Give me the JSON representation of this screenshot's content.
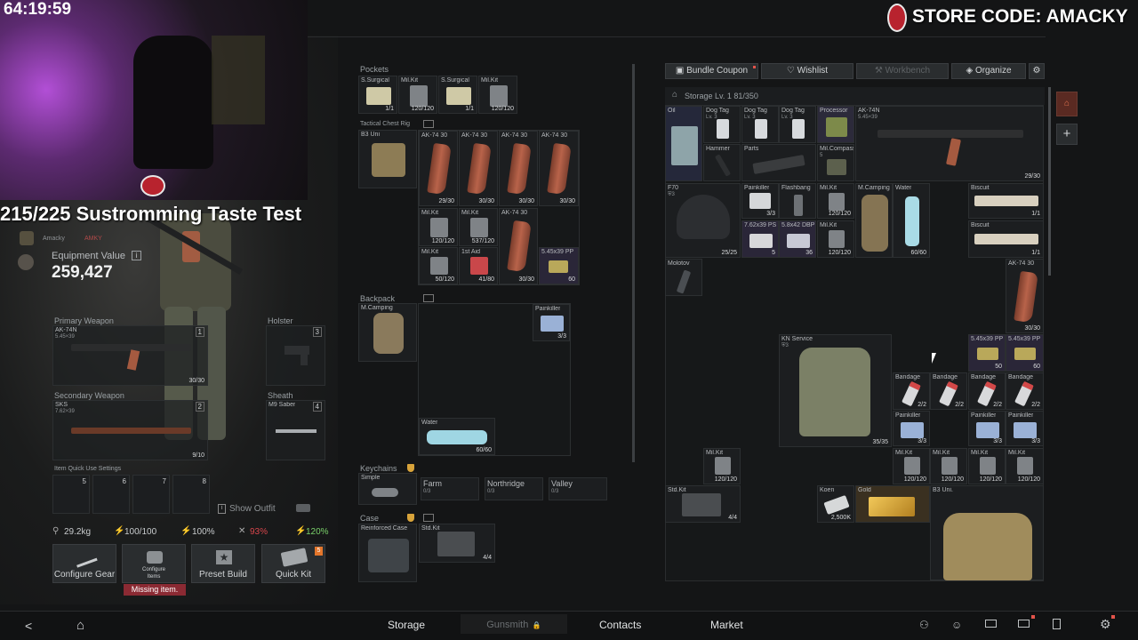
{
  "stream": {
    "timer": "64:19:59",
    "store_code": "STORE CODE: AMACKY",
    "title": "215/225 Sustromming Taste Test",
    "user_name": "Amacky",
    "user_tag": "AMKY"
  },
  "character": {
    "equipment_value_label": "Equipment Value",
    "equipment_value": "259,427",
    "primary_weapon": {
      "section": "Primary Weapon",
      "name": "AK-74N",
      "caliber": "5.45×39",
      "slot": "1",
      "ammo": "30/30"
    },
    "holster": {
      "section": "Holster",
      "slot": "3"
    },
    "secondary_weapon": {
      "section": "Secondary Weapon",
      "name": "SKS",
      "caliber": "7.62×39",
      "slot": "2",
      "ammo": "9/10"
    },
    "sheath": {
      "section": "Sheath",
      "name": "M9 Saber",
      "slot": "4"
    },
    "quick_use_label": "Item Quick Use Settings",
    "quick_use_slots": [
      "5",
      "6",
      "7",
      "8"
    ],
    "show_outfit": "Show Outfit",
    "stats": [
      "29.2kg",
      "100/100",
      "100%",
      "93%",
      "120%"
    ],
    "colors": {
      "stat_warning": "#d8464c",
      "stat_good": "#7ad16a"
    },
    "buttons": {
      "configure_gear": "Configure Gear",
      "configure_items": "Configure Items",
      "preset_build": "Preset Build",
      "quick_kit": "Quick Kit",
      "quick_kit_badge": "5"
    },
    "missing_item": "Missing item."
  },
  "loadout": {
    "pockets_label": "Pockets",
    "pockets": [
      {
        "name": "S.Surgical",
        "count": "1/1"
      },
      {
        "name": "Mil.Kit",
        "count": "120/120"
      },
      {
        "name": "S.Surgical",
        "count": "1/1"
      },
      {
        "name": "Mil.Kit",
        "count": "120/120"
      }
    ],
    "rig_label": "Tactical Chest Rig",
    "rig_name": "B3 Uni",
    "rig_items": [
      {
        "name": "AK-74 30",
        "count": "29/30"
      },
      {
        "name": "AK-74 30",
        "count": "30/30"
      },
      {
        "name": "AK-74 30",
        "count": "30/30"
      },
      {
        "name": "AK-74 30",
        "count": "30/30"
      },
      {
        "name": "Mil.Kit",
        "count": "120/120"
      },
      {
        "name": "Mil.Kit",
        "count": "537/120"
      },
      {
        "name": "AK-74 30",
        "count": "30/30"
      },
      {
        "name": "Mil.Kit",
        "count": "50/120"
      },
      {
        "name": "1st Aid",
        "count": "41/80"
      },
      {
        "name": "5.45x39 PP",
        "count": "60"
      }
    ],
    "backpack_label": "Backpack",
    "backpack_name": "M.Camping",
    "backpack_items": [
      {
        "name": "Painkiller",
        "count": "3/3"
      },
      {
        "name": "Water",
        "count": "60/60"
      }
    ],
    "keychains_label": "Keychains",
    "keychain_name": "Simple",
    "keys": [
      {
        "name": "Farm",
        "count": "0/3"
      },
      {
        "name": "Northridge",
        "count": "0/3"
      },
      {
        "name": "Valley",
        "count": "0/3"
      }
    ],
    "case_label": "Case",
    "case_name": "Reinforced Case",
    "case_items": [
      {
        "name": "Std.Kit",
        "count": "4/4"
      }
    ]
  },
  "storage": {
    "tabs": [
      "Bundle Coupon",
      "Wishlist",
      "Workbench",
      "Organize"
    ],
    "title": "Storage Lv. 1 81/350",
    "items": {
      "oil": "Oil",
      "dog_tag_1": "Dog Tag",
      "dog_tag_1_lv": "Lv. 3",
      "dog_tag_2": "Dog Tag",
      "dog_tag_2_lv": "Lv. 3",
      "dog_tag_3": "Dog Tag",
      "dog_tag_3_lv": "Lv. 3",
      "processor": "Processor",
      "ak74n": "AK-74N",
      "ak74n_cal": "5.45×39",
      "ak74n_ammo": "29/30",
      "hammer": "Hammer",
      "parts": "Parts",
      "mil_compass": "Mil.Compass",
      "mil_compass_count": "5",
      "f70": "F70",
      "f70_tier": "3",
      "f70_count": "25/25",
      "painkiller": "Painkiller",
      "painkiller_count": "3/3",
      "flashbang": "Flashbang",
      "milkit_a": "Mil.Kit",
      "milkit_a_count": "120/120",
      "mcamping": "M.Camping",
      "water": "Water",
      "water_count": "60/60",
      "biscuit_1": "Biscuit",
      "biscuit_1_count": "1/1",
      "biscuit_2": "Biscuit",
      "biscuit_2_count": "1/1",
      "ammo_762": "7.62x39 PS",
      "ammo_762_count": "5",
      "ammo_545": "5.8x42 DBP",
      "ammo_545_count": "36",
      "milkit_b": "Mil.Kit",
      "milkit_b_count": "120/120",
      "molotov": "Molotov",
      "ak74_30": "AK-74 30",
      "ak74_30_count": "30/30",
      "kn_service": "KN Service",
      "kn_service_tier": "3",
      "kn_service_count": "35/35",
      "pp_1": "5.45x39 PP",
      "pp_1_count": "50",
      "pp_2": "5.45x39 PP",
      "pp_2_count": "60",
      "bandage_1": "Bandage",
      "bandage_1_count": "2/2",
      "bandage_2": "Bandage",
      "bandage_2_count": "2/2",
      "bandage_3": "Bandage",
      "bandage_3_count": "2/2",
      "bandage_4": "Bandage",
      "bandage_4_count": "2/2",
      "painkiller_2": "Painkiller",
      "painkiller_2_count": "3/3",
      "painkiller_3": "Painkiller",
      "painkiller_3_count": "3/3",
      "painkiller_4": "Painkiller",
      "painkiller_4_count": "3/3",
      "milkit_c": "Mil.Kit",
      "milkit_c_count": "120/120",
      "milkit_d": "Mil.Kit",
      "milkit_d_count": "120/120",
      "milkit_e": "Mil.Kit",
      "milkit_e_count": "120/120",
      "milkit_f": "Mil.Kit",
      "milkit_f_count": "120/120",
      "milkit_g": "Mil.Kit",
      "milkit_g_count": "120/120",
      "stdkit": "Std.Kit",
      "stdkit_count": "4/4",
      "koen": "Koen",
      "koen_count": "2,500K",
      "gold": "Gold",
      "b3uni": "B3 Uni."
    }
  },
  "bottom_nav": {
    "storage": "Storage",
    "gunsmith": "Gunsmith",
    "contacts": "Contacts",
    "market": "Market"
  }
}
